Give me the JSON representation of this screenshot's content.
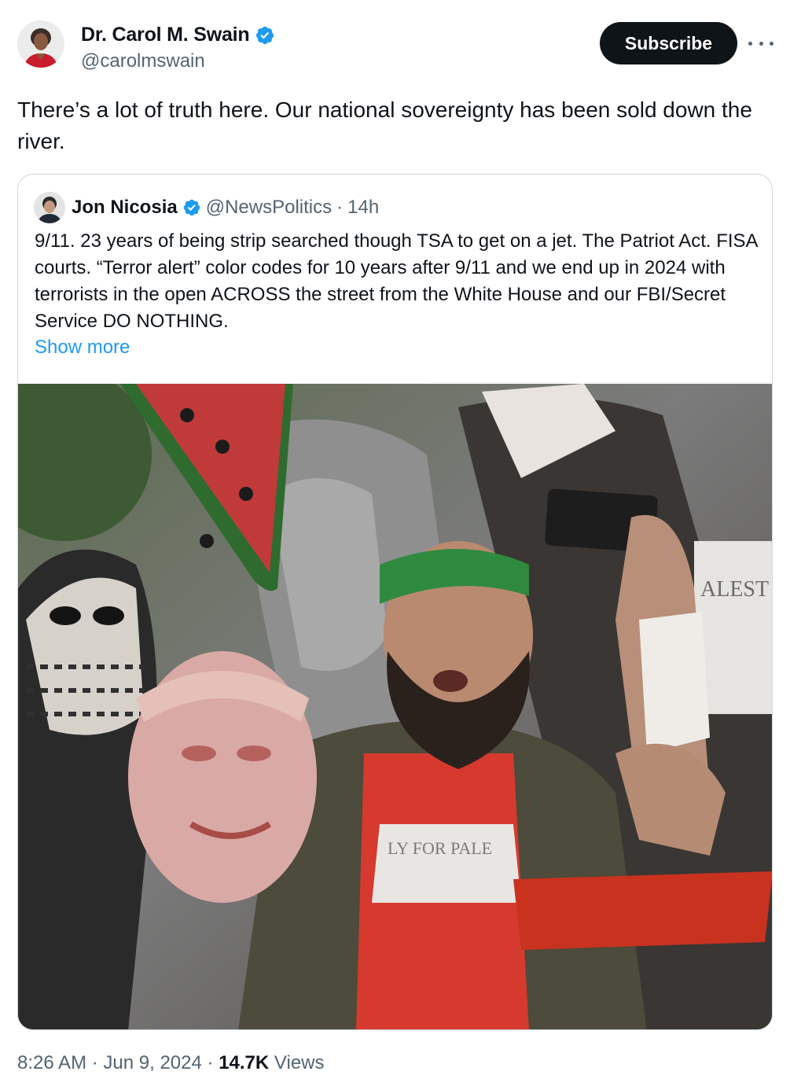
{
  "author": {
    "name": "Dr. Carol M. Swain",
    "handle": "@carolmswain",
    "verified": true,
    "avatar_icon": "profile-photo-woman"
  },
  "actions": {
    "subscribe_label": "Subscribe",
    "more_icon": "more-horizontal-icon"
  },
  "tweet": {
    "text": "There’s a lot of truth here. Our national sovereignty has been sold down the river."
  },
  "quoted": {
    "name": "Jon Nicosia",
    "handle": "@NewsPolitics",
    "separator": "·",
    "time": "14h",
    "verified": true,
    "text": "9/11.  23 years of being strip searched though TSA to get on a jet. The Patriot Act.  FISA courts.  “Terror alert” color codes for 10 years after 9/11 and we end up in 2024 with terrorists in the open ACROSS the street from the White House and our FBI/Secret Service DO NOTHING.",
    "show_more": "Show more"
  },
  "meta": {
    "time": "8:26 AM",
    "separator": "·",
    "date": "Jun 9, 2024",
    "views_count": "14.7K",
    "views_label": "Views"
  },
  "colors": {
    "link": "#1d9bf0",
    "verified": "#1d9bf0",
    "secondary_text": "#536471",
    "button_bg": "#0f1419"
  }
}
